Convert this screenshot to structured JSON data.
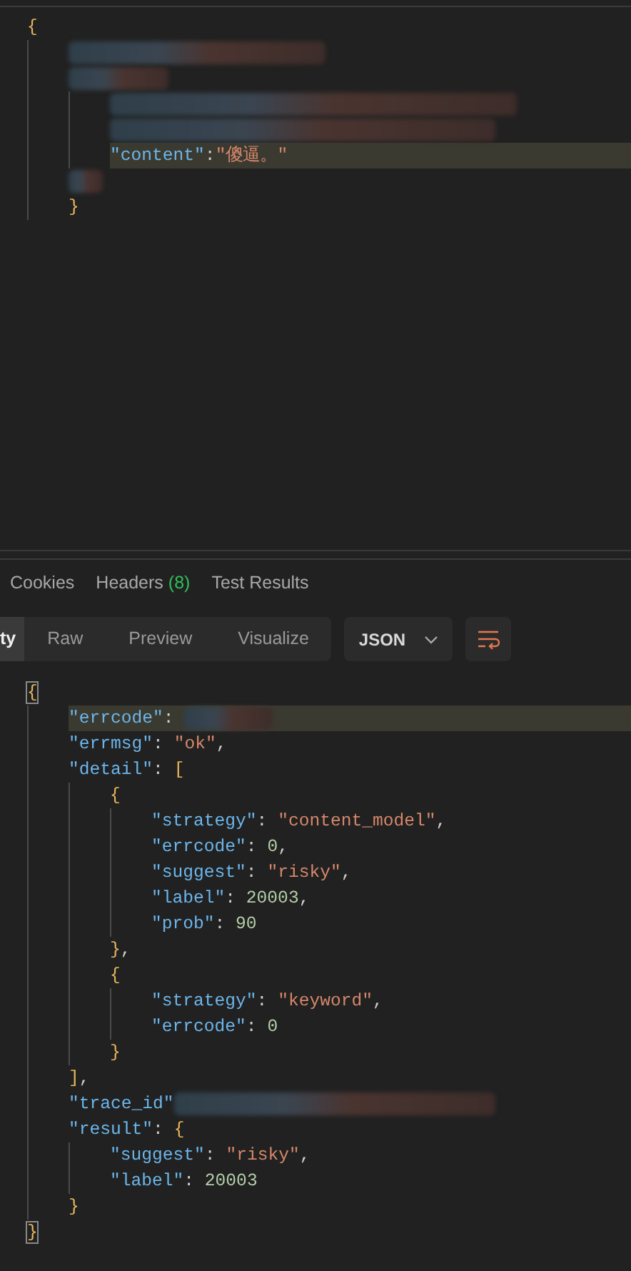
{
  "request_body": {
    "tokens": [
      {
        "kind": "bracket",
        "text": "{"
      }
    ],
    "children": [
      {
        "tokens": [
          {
            "kind": "blur"
          }
        ]
      },
      {
        "tokens": [
          {
            "kind": "blur"
          }
        ],
        "children": [
          {
            "tokens": [
              {
                "kind": "blur"
              }
            ]
          },
          {
            "tokens": [
              {
                "kind": "blur"
              }
            ]
          },
          {
            "highlighted": true,
            "tokens": [
              {
                "kind": "key",
                "text": "\"content\""
              },
              {
                "kind": "punct",
                "text": ":"
              },
              {
                "kind": "str",
                "text": "\"傻逼。\""
              }
            ]
          }
        ]
      },
      {
        "tokens": [
          {
            "kind": "blur"
          }
        ]
      },
      {
        "tokens": [
          {
            "kind": "bracket",
            "text": "}"
          }
        ]
      }
    ]
  },
  "response_tabs": [
    {
      "label": "Cookies"
    },
    {
      "label": "Headers",
      "count": "(8)"
    },
    {
      "label": "Test Results"
    }
  ],
  "view_modes": [
    {
      "label": "ty",
      "selected": true
    },
    {
      "label": "Raw",
      "selected": false
    },
    {
      "label": "Preview",
      "selected": false
    },
    {
      "label": "Visualize",
      "selected": false
    }
  ],
  "format_dropdown": {
    "value": "JSON"
  },
  "response_body": {
    "tokens": [
      {
        "kind": "match",
        "text": "{"
      }
    ],
    "children": [
      {
        "highlighted": true,
        "tokens": [
          {
            "kind": "key",
            "text": "\"errcode\""
          },
          {
            "kind": "punct",
            "text": ": "
          },
          {
            "kind": "blur"
          }
        ]
      },
      {
        "tokens": [
          {
            "kind": "key",
            "text": "\"errmsg\""
          },
          {
            "kind": "punct",
            "text": ": "
          },
          {
            "kind": "str",
            "text": "\"ok\""
          },
          {
            "kind": "punct",
            "text": ","
          }
        ]
      },
      {
        "tokens": [
          {
            "kind": "key",
            "text": "\"detail\""
          },
          {
            "kind": "punct",
            "text": ": "
          },
          {
            "kind": "bracket",
            "text": "["
          }
        ],
        "children": [
          {
            "tokens": [
              {
                "kind": "bracket",
                "text": "{"
              }
            ],
            "children": [
              {
                "tokens": [
                  {
                    "kind": "key",
                    "text": "\"strategy\""
                  },
                  {
                    "kind": "punct",
                    "text": ": "
                  },
                  {
                    "kind": "str",
                    "text": "\"content_model\""
                  },
                  {
                    "kind": "punct",
                    "text": ","
                  }
                ]
              },
              {
                "tokens": [
                  {
                    "kind": "key",
                    "text": "\"errcode\""
                  },
                  {
                    "kind": "punct",
                    "text": ": "
                  },
                  {
                    "kind": "num",
                    "text": "0"
                  },
                  {
                    "kind": "punct",
                    "text": ","
                  }
                ]
              },
              {
                "tokens": [
                  {
                    "kind": "key",
                    "text": "\"suggest\""
                  },
                  {
                    "kind": "punct",
                    "text": ": "
                  },
                  {
                    "kind": "str",
                    "text": "\"risky\""
                  },
                  {
                    "kind": "punct",
                    "text": ","
                  }
                ]
              },
              {
                "tokens": [
                  {
                    "kind": "key",
                    "text": "\"label\""
                  },
                  {
                    "kind": "punct",
                    "text": ": "
                  },
                  {
                    "kind": "num",
                    "text": "20003"
                  },
                  {
                    "kind": "punct",
                    "text": ","
                  }
                ]
              },
              {
                "tokens": [
                  {
                    "kind": "key",
                    "text": "\"prob\""
                  },
                  {
                    "kind": "punct",
                    "text": ": "
                  },
                  {
                    "kind": "num",
                    "text": "90"
                  }
                ]
              }
            ],
            "close": [
              {
                "kind": "bracket",
                "text": "}"
              },
              {
                "kind": "punct",
                "text": ","
              }
            ]
          },
          {
            "tokens": [
              {
                "kind": "bracket",
                "text": "{"
              }
            ],
            "children": [
              {
                "tokens": [
                  {
                    "kind": "key",
                    "text": "\"strategy\""
                  },
                  {
                    "kind": "punct",
                    "text": ": "
                  },
                  {
                    "kind": "str",
                    "text": "\"keyword\""
                  },
                  {
                    "kind": "punct",
                    "text": ","
                  }
                ]
              },
              {
                "tokens": [
                  {
                    "kind": "key",
                    "text": "\"errcode\""
                  },
                  {
                    "kind": "punct",
                    "text": ": "
                  },
                  {
                    "kind": "num",
                    "text": "0"
                  }
                ]
              }
            ],
            "close": [
              {
                "kind": "bracket",
                "text": "}"
              }
            ]
          }
        ],
        "close": [
          {
            "kind": "bracket",
            "text": "]"
          },
          {
            "kind": "punct",
            "text": ","
          }
        ]
      },
      {
        "tokens": [
          {
            "kind": "key",
            "text": "\"trace_id\""
          },
          {
            "kind": "blur"
          }
        ]
      },
      {
        "tokens": [
          {
            "kind": "key",
            "text": "\"result\""
          },
          {
            "kind": "punct",
            "text": ": "
          },
          {
            "kind": "bracket",
            "text": "{"
          }
        ],
        "children": [
          {
            "tokens": [
              {
                "kind": "key",
                "text": "\"suggest\""
              },
              {
                "kind": "punct",
                "text": ": "
              },
              {
                "kind": "str",
                "text": "\"risky\""
              },
              {
                "kind": "punct",
                "text": ","
              }
            ]
          },
          {
            "tokens": [
              {
                "kind": "key",
                "text": "\"label\""
              },
              {
                "kind": "punct",
                "text": ": "
              },
              {
                "kind": "num",
                "text": "20003"
              }
            ]
          }
        ],
        "close": [
          {
            "kind": "bracket",
            "text": "}"
          }
        ]
      }
    ],
    "close": [
      {
        "kind": "match",
        "text": "}"
      }
    ]
  }
}
